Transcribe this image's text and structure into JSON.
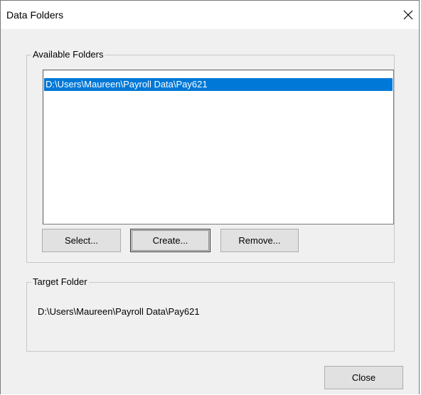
{
  "window": {
    "title": "Data Folders"
  },
  "available": {
    "legend": "Available Folders",
    "items": [
      "D:\\Users\\Maureen\\Payroll Data\\Pay621"
    ],
    "selected_index": 0
  },
  "buttons": {
    "select": "Select...",
    "create": "Create...",
    "remove": "Remove...",
    "close": "Close"
  },
  "target": {
    "legend": "Target Folder",
    "path": "D:\\Users\\Maureen\\Payroll Data\\Pay621"
  },
  "colors": {
    "selection": "#0078d7",
    "dialog_bg": "#f0f0f0"
  },
  "icons": {
    "close": "close-icon"
  }
}
